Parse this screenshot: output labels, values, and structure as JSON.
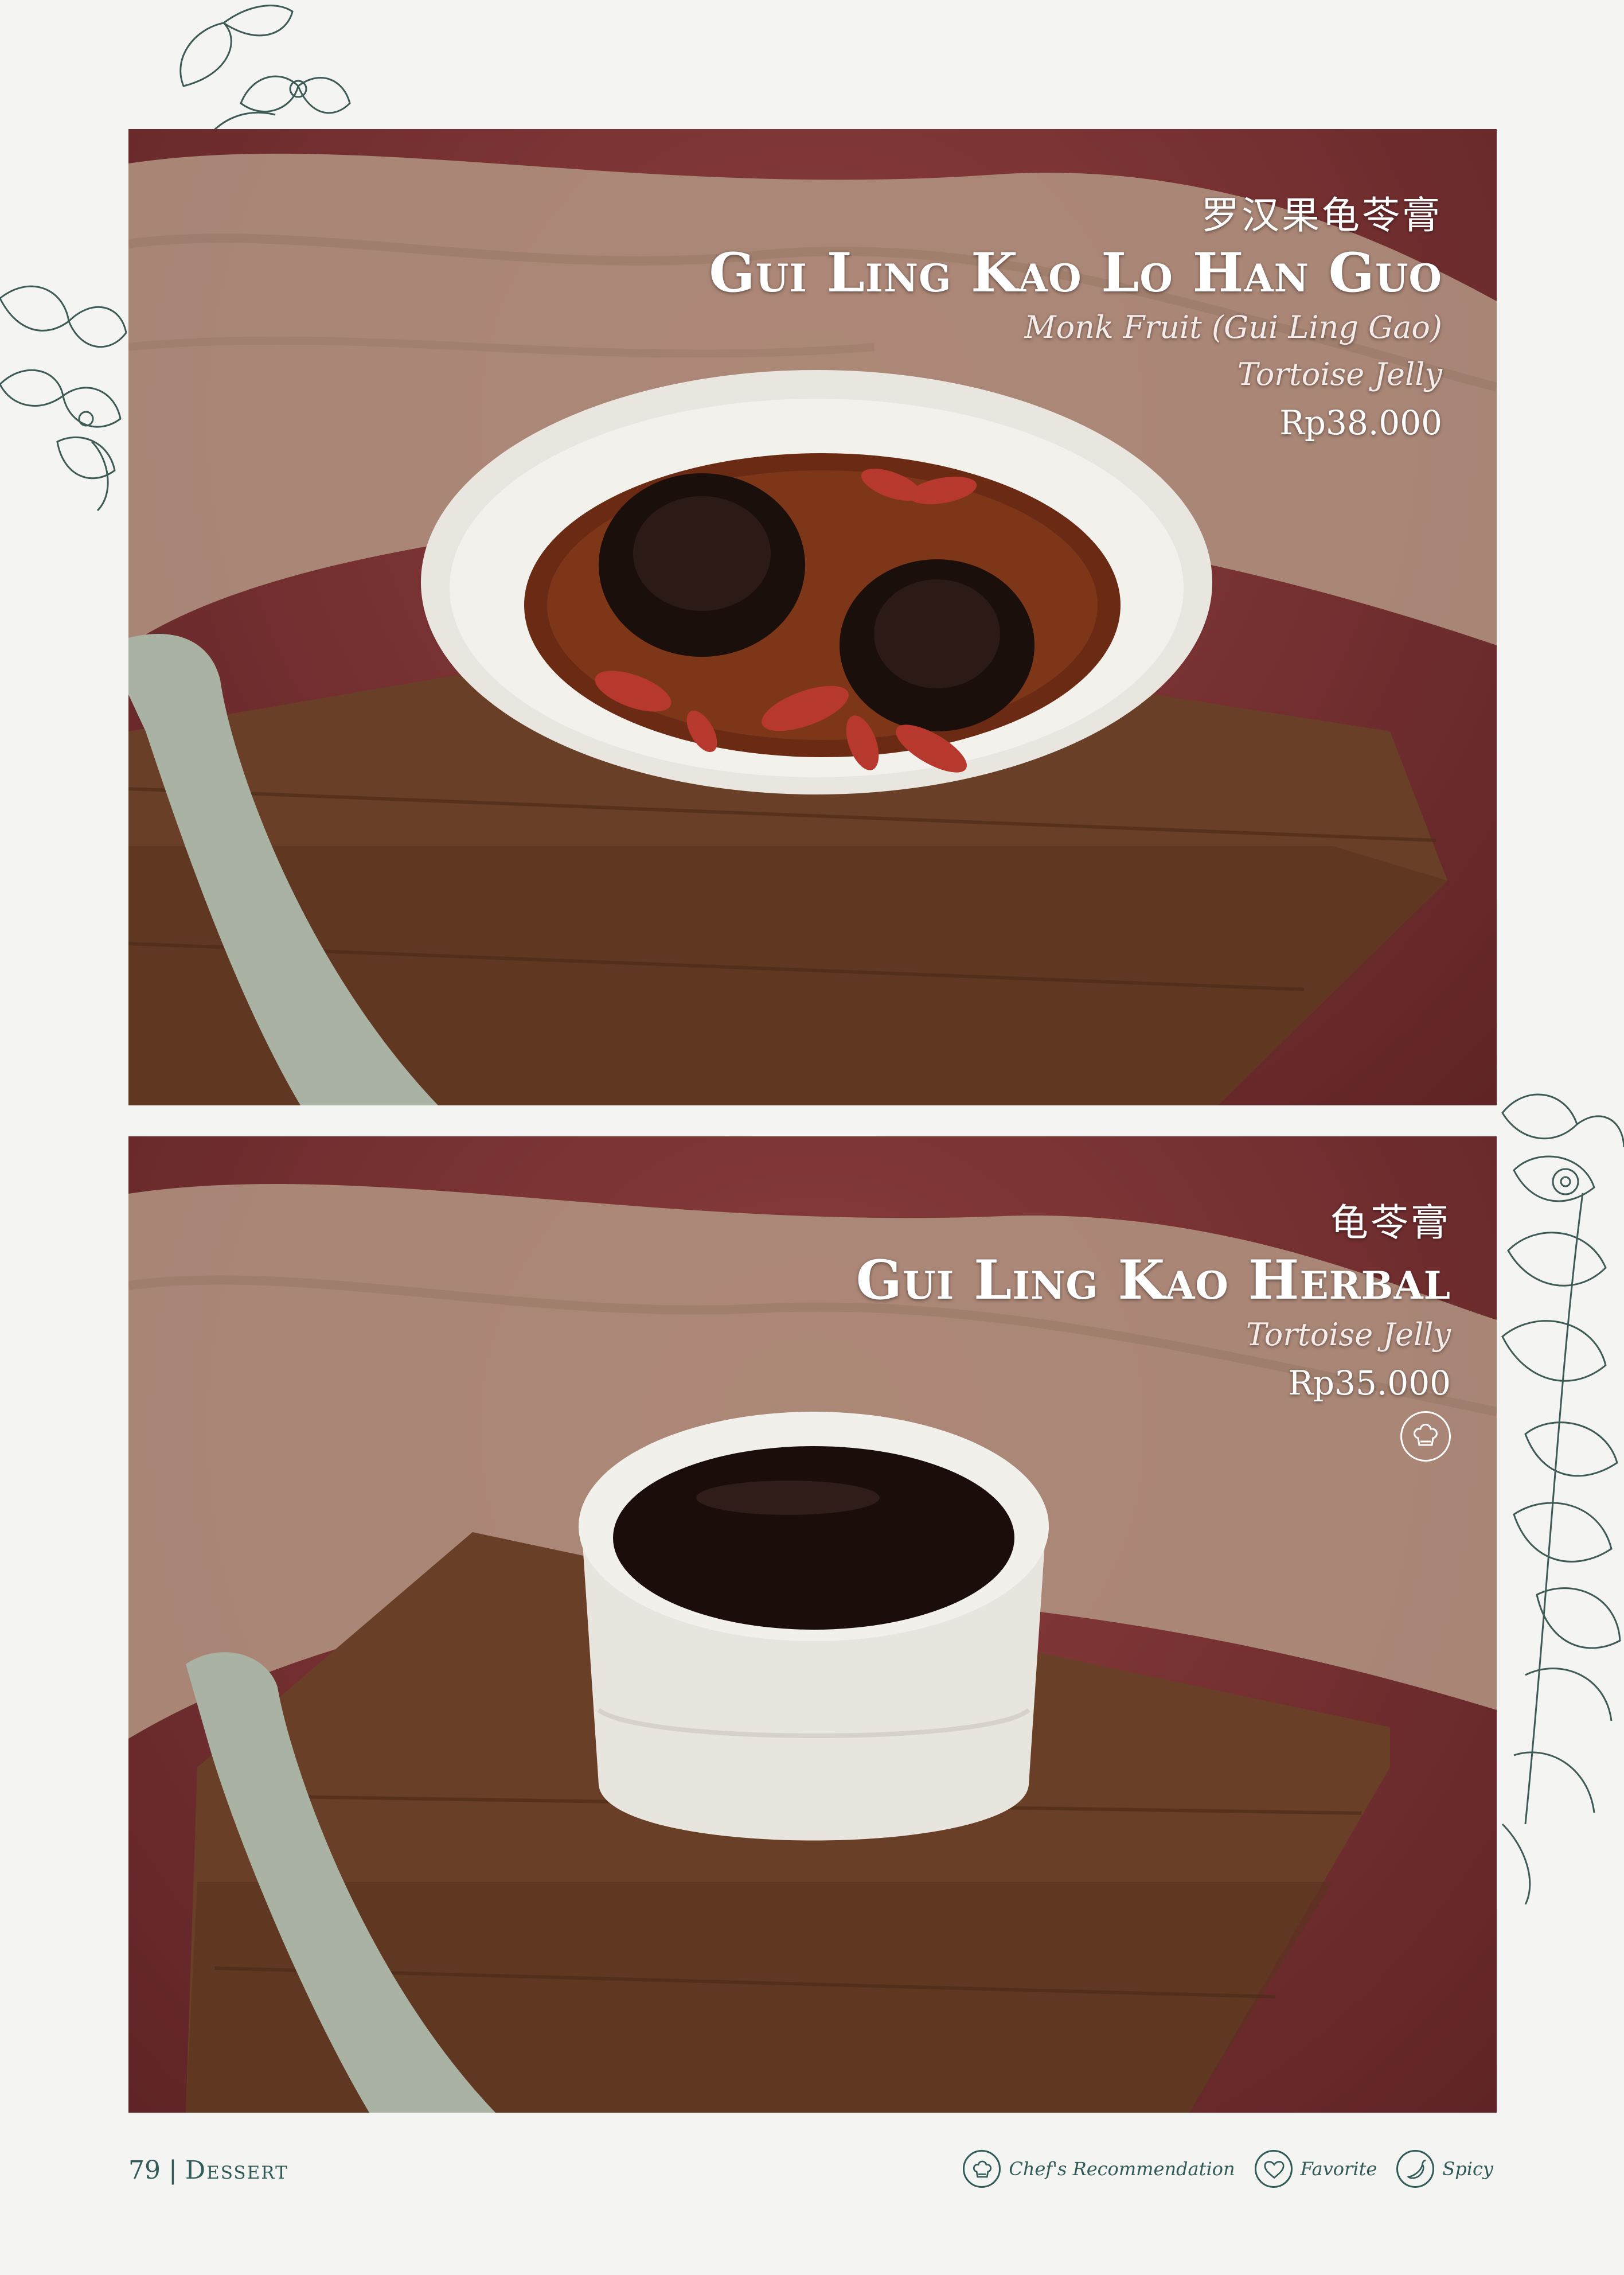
{
  "menu_items": [
    {
      "chinese_name": "罗汉果龟苓膏",
      "name": "Gui Ling Kao Lo Han Guo",
      "description_line1": "Monk Fruit (Gui Ling Gao)",
      "description_line2": "Tortoise Jelly",
      "price": "Rp38.000"
    },
    {
      "chinese_name": "龟苓膏",
      "name": "Gui Ling Kao Herbal",
      "description_line1": "Tortoise Jelly",
      "price": "Rp35.000",
      "badge_icon": "chef-hat-icon"
    }
  ],
  "footer": {
    "page_number": "79",
    "separator": "|",
    "section": "Dessert"
  },
  "legend": [
    {
      "icon": "chef-hat-icon",
      "label": "Chef's Recommendation"
    },
    {
      "icon": "heart-icon",
      "label": "Favorite"
    },
    {
      "icon": "chili-icon",
      "label": "Spicy"
    }
  ],
  "colors": {
    "accent": "#2f5a55",
    "background": "#f4f4f3",
    "photo_backdrop": "#7b3334"
  }
}
